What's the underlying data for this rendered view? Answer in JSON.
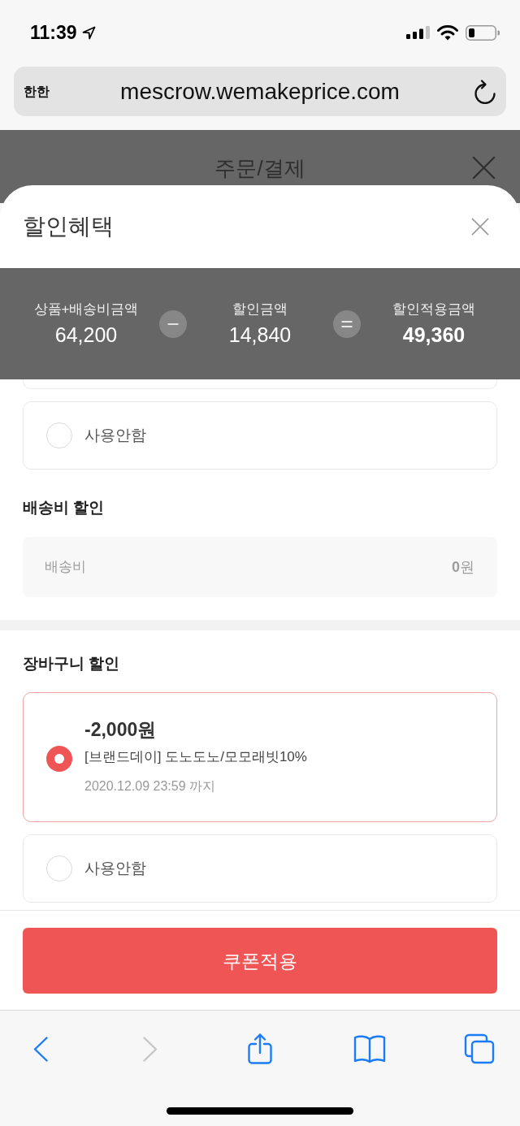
{
  "status_bar": {
    "time": "11:39"
  },
  "address_bar": {
    "text_size_label": "한한",
    "url": "mescrow.wemakeprice.com"
  },
  "page_header": {
    "title": "주문/결제"
  },
  "sheet": {
    "title": "할인혜택",
    "summary": [
      {
        "kind": "amount",
        "label": "상품+배송비금액",
        "value": "64,200",
        "emphasized": false
      },
      {
        "kind": "minus"
      },
      {
        "kind": "amount",
        "label": "할인금액",
        "value": "14,840",
        "emphasized": false
      },
      {
        "kind": "equals"
      },
      {
        "kind": "amount",
        "label": "할인적용금액",
        "value": "49,360",
        "emphasized": true
      }
    ],
    "sections": [
      {
        "clipped_card_above": true,
        "options": [
          {
            "kind": "plain",
            "label": "사용안함",
            "selected": false
          }
        ]
      },
      {
        "heading": "배송비 할인",
        "fee": {
          "label": "배송비",
          "value": "**0**원"
        }
      },
      {
        "heading": "장바구니 할인",
        "divider_above": true,
        "options": [
          {
            "kind": "coupon",
            "amount": "-2,000원",
            "title": "[브랜드데이] 도노도노/모모래빗10%",
            "expiry": "2020.12.09 23:59 까지",
            "selected": true
          },
          {
            "kind": "plain",
            "label": "사용안함",
            "selected": false
          }
        ]
      }
    ],
    "apply_button": {
      "label": "쿠폰적용"
    }
  },
  "browser_toolbar": [
    {
      "kind": "back",
      "disabled": false
    },
    {
      "kind": "forward",
      "disabled": true
    },
    {
      "kind": "share",
      "disabled": false
    },
    {
      "kind": "bookmarks",
      "disabled": false
    },
    {
      "kind": "tabs",
      "disabled": false
    }
  ]
}
